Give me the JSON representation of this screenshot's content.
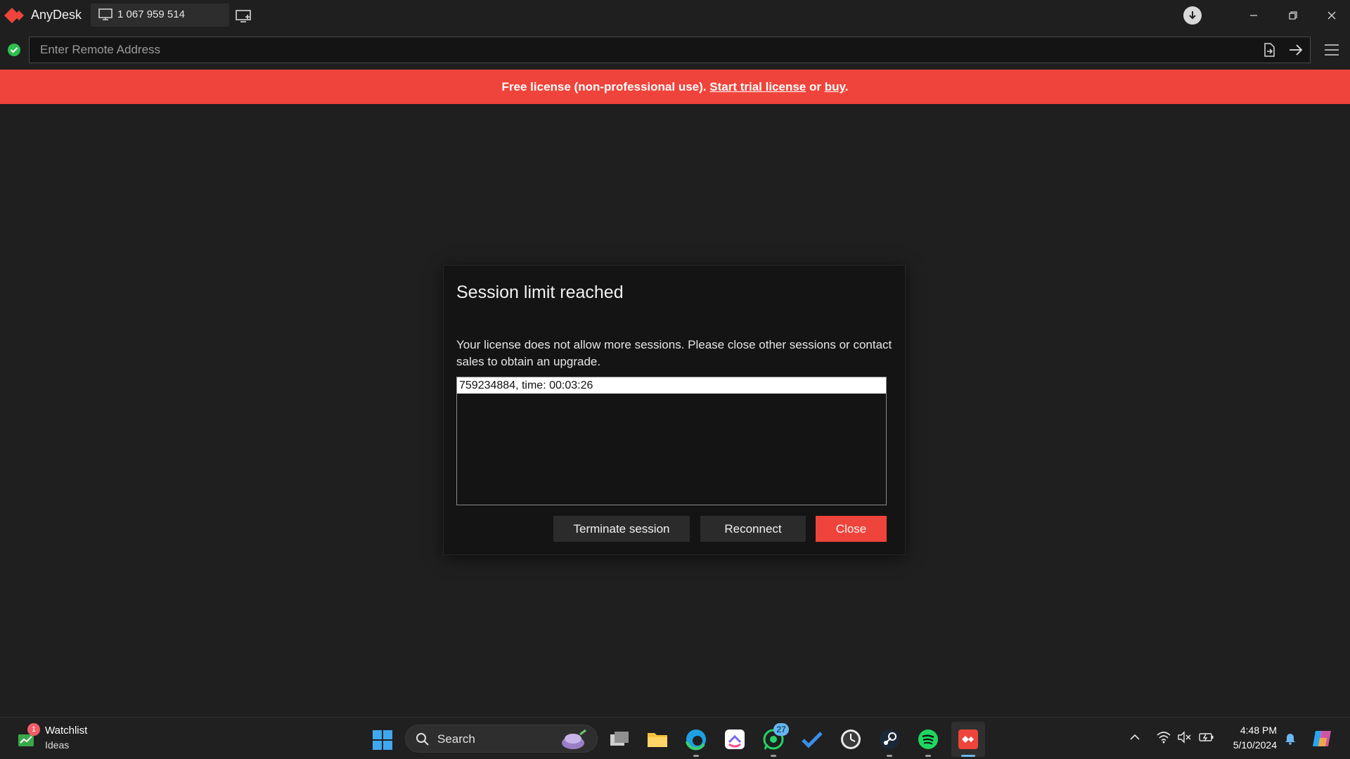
{
  "app": {
    "name": "AnyDesk",
    "own_address": "1 067 959 514"
  },
  "address_bar": {
    "placeholder": "Enter Remote Address"
  },
  "banner": {
    "prefix": "Free license (non-professional use).",
    "trial_link": "Start trial license",
    "or_text": "or",
    "buy_link": "buy",
    "suffix": "."
  },
  "dialog": {
    "title": "Session limit reached",
    "message": "Your license does not allow more sessions. Please close other sessions or contact sales to obtain an upgrade.",
    "sessions": [
      "759234884, time: 00:03:26"
    ],
    "buttons": {
      "terminate": "Terminate session",
      "reconnect": "Reconnect",
      "close": "Close"
    }
  },
  "taskbar": {
    "widget": {
      "badge": "1",
      "title": "Watchlist",
      "subtitle": "Ideas"
    },
    "search_label": "Search",
    "whatsapp_badge": "27",
    "clock": {
      "time": "4:48 PM",
      "date": "5/10/2024"
    }
  },
  "colors": {
    "accent": "#ef443b",
    "background": "#1f1f1f",
    "dialog": "#141414"
  },
  "icons": [
    "anydesk-logo-icon",
    "monitor-icon",
    "new-session-icon",
    "update-icon",
    "minimize-icon",
    "restore-icon",
    "close-icon",
    "connected-check-icon",
    "file-transfer-icon",
    "arrow-right-icon",
    "hamburger-menu-icon",
    "windows-start-icon",
    "search-icon",
    "task-view-icon",
    "file-explorer-icon",
    "edge-icon",
    "clickup-icon",
    "whatsapp-icon",
    "todo-icon",
    "clock-app-icon",
    "steam-icon",
    "spotify-icon",
    "anydesk-taskbar-icon",
    "wifi-icon",
    "volume-muted-icon",
    "battery-icon",
    "bell-icon",
    "copilot-icon"
  ]
}
